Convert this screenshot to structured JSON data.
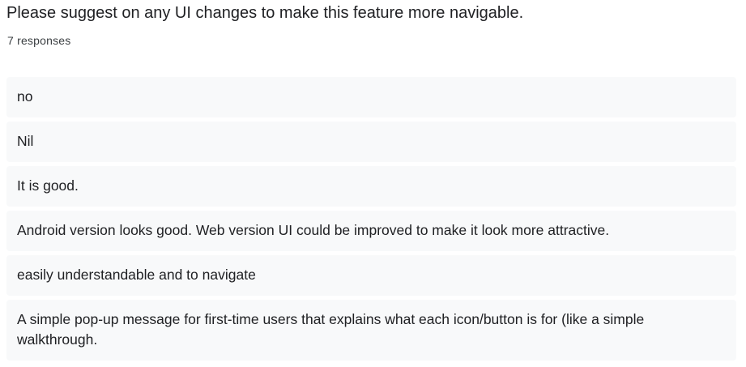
{
  "question": {
    "title": "Please suggest on any UI changes to make this feature more navigable.",
    "response_count": "7 responses"
  },
  "responses": [
    "no",
    "Nil",
    "It is good.",
    "Android version looks good. Web version UI could be improved to make it look more attractive.",
    "easily understandable and to navigate",
    "A simple pop-up message for first-time users that explains what each icon/button is for (like a simple walkthrough."
  ]
}
